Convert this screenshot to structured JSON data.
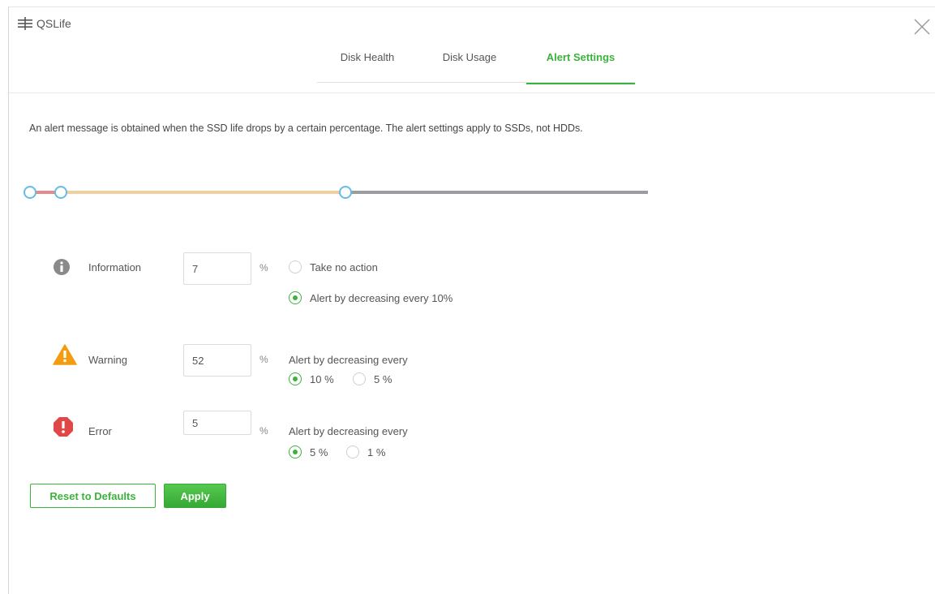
{
  "app": {
    "title": "QSLife"
  },
  "tabs": [
    {
      "label": "Disk Health",
      "active": false
    },
    {
      "label": "Disk Usage",
      "active": false
    },
    {
      "label": "Alert Settings",
      "active": true
    }
  ],
  "description": "An alert message is obtained when the SSD life drops by a certain percentage. The alert settings apply to SSDs, not HDDs.",
  "slider": {
    "thresholds": {
      "error": 5,
      "warning": 52,
      "information": 7
    },
    "colors": {
      "error_segment": "#e58a8a",
      "warning_segment": "#f3cfa0",
      "normal_segment": "#9a9ca0",
      "knob_border": "#65bce5"
    }
  },
  "levels": {
    "information": {
      "icon": "info-icon",
      "label": "Information",
      "value": "7",
      "unit": "%",
      "options": [
        {
          "label": "Take no action",
          "checked": false
        },
        {
          "label": "Alert by decreasing every 10%",
          "checked": true
        }
      ]
    },
    "warning": {
      "icon": "warning-icon",
      "label": "Warning",
      "value": "52",
      "unit": "%",
      "hint": "Alert by decreasing every",
      "options": [
        {
          "label": "10 %",
          "checked": true
        },
        {
          "label": "5 %",
          "checked": false
        }
      ]
    },
    "error": {
      "icon": "error-icon",
      "label": "Error",
      "value": "5",
      "unit": "%",
      "hint": "Alert by decreasing every",
      "options": [
        {
          "label": "5 %",
          "checked": true
        },
        {
          "label": "1 %",
          "checked": false
        }
      ]
    }
  },
  "buttons": {
    "reset": "Reset to Defaults",
    "apply": "Apply"
  },
  "colors": {
    "accent": "#3bb33b",
    "warning": "#f39c12",
    "error": "#e04848",
    "info": "#8a8a8a"
  }
}
